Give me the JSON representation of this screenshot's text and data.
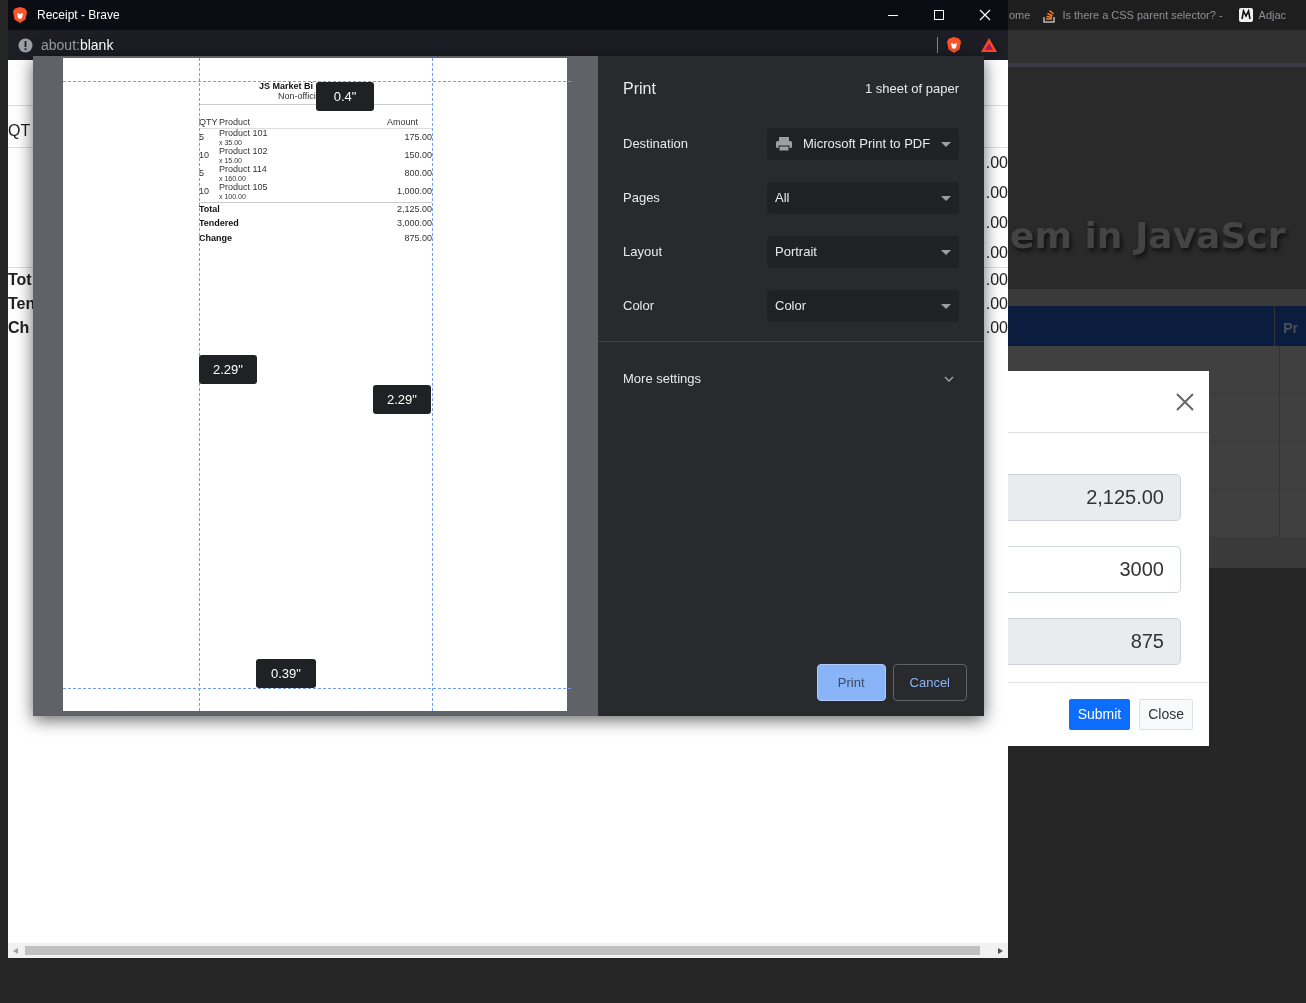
{
  "background_browser": {
    "tabs": [
      {
        "title": "ome",
        "kind": "plain"
      },
      {
        "title": "Is there a CSS parent selector? -",
        "kind": "stack"
      },
      {
        "title": "Adjac",
        "kind": "letter"
      }
    ],
    "heading": "em in JavaScr",
    "table": {
      "columns": [
        "Pr"
      ]
    },
    "modal": {
      "fields": [
        {
          "value": "2,125.00",
          "readonly": true
        },
        {
          "value": "3000",
          "readonly": false
        },
        {
          "value": "875",
          "readonly": true
        }
      ],
      "buttons": [
        {
          "label": "Submit",
          "kind": "primary"
        },
        {
          "label": "Close",
          "kind": "secondary"
        }
      ]
    }
  },
  "popup": {
    "title": "Receipt - Brave",
    "address": {
      "scheme": "about:",
      "path": "blank"
    },
    "page_rows": [
      {
        "left": "QT",
        "bold": false
      },
      {
        "right": ".00"
      },
      {
        "right": ".00"
      },
      {
        "right": ".00"
      },
      {
        "right": ".00"
      },
      {
        "left": "Tot",
        "right": ".00",
        "bold": true
      },
      {
        "left": "Ten",
        "right": ".00",
        "bold": true
      },
      {
        "left": "Ch",
        "right": ".00",
        "bold": true
      }
    ]
  },
  "print_dialog": {
    "preview": {
      "shop": "JS Market Bi",
      "subtitle": "Non-offici",
      "columns": [
        "QTY",
        "Product",
        "Amount"
      ],
      "items": [
        {
          "qty": "5",
          "name": "Product 101",
          "price": "x 35.00",
          "amount": "175.00"
        },
        {
          "qty": "10",
          "name": "Product 102",
          "price": "x 15.00",
          "amount": "150.00"
        },
        {
          "qty": "5",
          "name": "Product 114",
          "price": "x 160.00",
          "amount": "800.00"
        },
        {
          "qty": "10",
          "name": "Product 105",
          "price": "x 100.00",
          "amount": "1,000.00"
        }
      ],
      "totals": [
        {
          "label": "Total",
          "value": "2,125.00"
        },
        {
          "label": "Tendered",
          "value": "3,000.00"
        },
        {
          "label": "Change",
          "value": "875.00"
        }
      ],
      "margin_labels": [
        "0.4\"",
        "2.29\"",
        "2.29\"",
        "0.39\""
      ]
    },
    "title": "Print",
    "sheets": "1 sheet of paper",
    "settings": [
      {
        "label": "Destination",
        "value": "Microsoft Print to PDF",
        "kind": "device"
      },
      {
        "label": "Pages",
        "value": "All",
        "kind": "option"
      },
      {
        "label": "Layout",
        "value": "Portrait",
        "kind": "option"
      },
      {
        "label": "Color",
        "value": "Color",
        "kind": "option"
      }
    ],
    "more_settings": "More settings",
    "buttons": [
      {
        "label": "Print",
        "kind": "primary"
      },
      {
        "label": "Cancel",
        "kind": "secondary"
      }
    ]
  }
}
